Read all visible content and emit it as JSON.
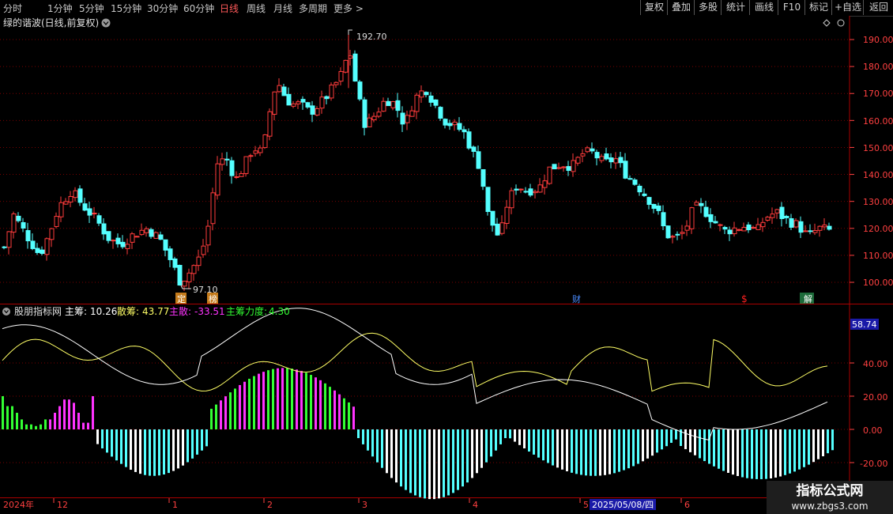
{
  "toolbar": {
    "tabs": [
      "分时",
      "1分钟",
      "5分钟",
      "15分钟",
      "30分钟",
      "60分钟",
      "日线",
      "周线",
      "月线",
      "多周期",
      "更多 >"
    ],
    "active_tab": "日线",
    "right_buttons": [
      "复权",
      "叠加",
      "多股",
      "统计",
      "画线",
      "F10",
      "标记",
      "+自选",
      "返回"
    ]
  },
  "main_panel": {
    "title": "绿的谐波(日线,前复权)",
    "high_label": "192.70",
    "low_label": "97.10",
    "price_axis": [
      "190.00",
      "180.00",
      "170.00",
      "160.00",
      "150.00",
      "140.00",
      "130.00",
      "120.00",
      "110.00",
      "100.00"
    ],
    "markers": [
      "定",
      "榜",
      "财",
      "$",
      "解"
    ]
  },
  "indicator_panel": {
    "name": "股朋指标网",
    "zhu_chou_label": "主筹:",
    "zhu_chou_value": "10.26",
    "san_chou_label": "散筹:",
    "san_chou_value": "43.77",
    "zhu_san_label": "主散:",
    "zhu_san_value": "-33.51",
    "li_du_label": "主筹力度:",
    "li_du_value": "4.30",
    "axis_labels": [
      "40.00",
      "20.00",
      "0.00",
      "-20.00"
    ],
    "current_value_badge": "58.74"
  },
  "time_axis": {
    "labels": [
      "2024年",
      "12",
      "1",
      "2",
      "3",
      "4",
      "5",
      "6"
    ],
    "cursor_date": "2025/05/08/四"
  },
  "watermark": {
    "line1": "指标公式网",
    "line2": "www.zbgs3.com"
  },
  "colors": {
    "up": "#ff3c3c",
    "down": "#54ffff",
    "yellow_line": "#ffff66",
    "white_line": "#ffffff",
    "magenta_bar": "#ff33ff",
    "green_bar": "#33ff33",
    "grid": "#7a0000"
  }
}
